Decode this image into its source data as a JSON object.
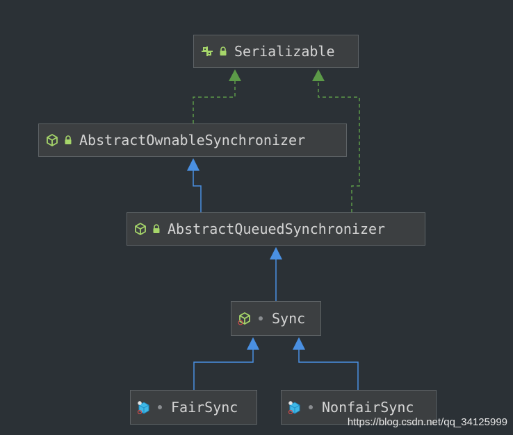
{
  "nodes": {
    "serializable": {
      "label": "Serializable",
      "icon": "interface-icon",
      "modifier": "lock-icon"
    },
    "abstract_ownable_synchronizer": {
      "label": "AbstractOwnableSynchronizer",
      "icon": "abstract-class-icon",
      "modifier": "lock-icon"
    },
    "abstract_queued_synchronizer": {
      "label": "AbstractQueuedSynchronizer",
      "icon": "abstract-class-icon",
      "modifier": "lock-icon"
    },
    "sync": {
      "label": "Sync",
      "icon": "abstract-class-icon",
      "modifier": "package-private-dot-icon"
    },
    "fair_sync": {
      "label": "FairSync",
      "icon": "class-icon",
      "modifier": "package-private-dot-icon"
    },
    "nonfair_sync": {
      "label": "NonfairSync",
      "icon": "class-icon",
      "modifier": "package-private-dot-icon"
    }
  },
  "edges": [
    {
      "from": "abstract_ownable_synchronizer",
      "to": "serializable",
      "kind": "implements"
    },
    {
      "from": "abstract_queued_synchronizer",
      "to": "serializable",
      "kind": "implements"
    },
    {
      "from": "abstract_queued_synchronizer",
      "to": "abstract_ownable_synchronizer",
      "kind": "extends"
    },
    {
      "from": "sync",
      "to": "abstract_queued_synchronizer",
      "kind": "extends"
    },
    {
      "from": "fair_sync",
      "to": "sync",
      "kind": "extends"
    },
    {
      "from": "nonfair_sync",
      "to": "sync",
      "kind": "extends"
    }
  ],
  "colors": {
    "background": "#2b3136",
    "node_fill": "#3c3f41",
    "extends_edge": "#4a90e2",
    "implements_edge": "#5c9a48",
    "lock": "#a6d66a",
    "interface_icon": "#a6d66a",
    "class_icon": "#3fb8e6"
  },
  "watermark": "https://blog.csdn.net/qq_34125999"
}
